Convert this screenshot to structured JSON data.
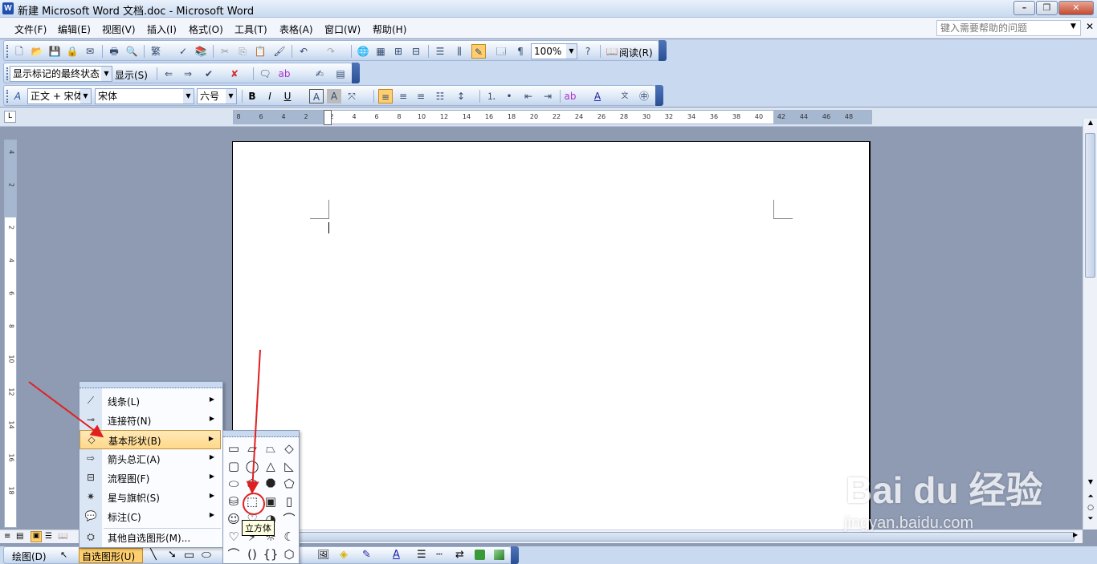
{
  "window": {
    "title": "新建 Microsoft Word 文档.doc - Microsoft Word",
    "app_icon": "W"
  },
  "menubar": {
    "items": [
      "文件(F)",
      "编辑(E)",
      "视图(V)",
      "插入(I)",
      "格式(O)",
      "工具(T)",
      "表格(A)",
      "窗口(W)",
      "帮助(H)"
    ],
    "help_placeholder": "键入需要帮助的问题"
  },
  "toolbar_standard": {
    "zoom": "100%",
    "read_label": "阅读(R)"
  },
  "toolbar_review": {
    "markup_combo": "显示标记的最终状态",
    "show_label": "显示(S)"
  },
  "toolbar_format": {
    "style": "正文 + 宋体",
    "font": "宋体",
    "size": "六号",
    "bold": "B",
    "italic": "I",
    "underline": "U"
  },
  "ruler": {
    "h_ticks": [
      "8",
      "6",
      "4",
      "2",
      "2",
      "4",
      "6",
      "8",
      "10",
      "12",
      "14",
      "16",
      "18",
      "20",
      "22",
      "24",
      "26",
      "28",
      "30",
      "32",
      "34",
      "36",
      "38",
      "40",
      "42",
      "44",
      "46",
      "48"
    ],
    "v_ticks": [
      "4",
      "2",
      "2",
      "4",
      "6",
      "8",
      "10",
      "12",
      "14",
      "16",
      "18"
    ]
  },
  "autoshapes_menu": {
    "items": [
      {
        "label": "线条(L)",
        "icon": "lines-icon",
        "glyph": "⟋"
      },
      {
        "label": "连接符(N)",
        "icon": "connector-icon",
        "glyph": "⊸"
      },
      {
        "label": "基本形状(B)",
        "icon": "basic-shapes-icon",
        "glyph": "◇"
      },
      {
        "label": "箭头总汇(A)",
        "icon": "arrows-icon",
        "glyph": "⇨"
      },
      {
        "label": "流程图(F)",
        "icon": "flowchart-icon",
        "glyph": "⊟"
      },
      {
        "label": "星与旗帜(S)",
        "icon": "stars-icon",
        "glyph": "✷"
      },
      {
        "label": "标注(C)",
        "icon": "callout-icon",
        "glyph": "💬"
      }
    ],
    "more_label": "其他自选图形(M)..."
  },
  "basic_shapes": {
    "glyphs": [
      "▭",
      "▱",
      "⏢",
      "◇",
      "▢",
      "◯",
      "△",
      "◺",
      "⬭",
      "⬡",
      "⯃",
      "⬠",
      "⛁",
      "⬚",
      "▣",
      "▯",
      "☺",
      "♡",
      "◔",
      "⌒",
      "♡",
      "⚡",
      "☼",
      "☾",
      "⌒",
      "()",
      "{}",
      "⬡"
    ],
    "tooltip": "立方体"
  },
  "drawing_toolbar": {
    "draw_label": "绘图(D)",
    "autoshapes_label": "自选图形(U)"
  },
  "watermark": {
    "brand": "Bai du 经验",
    "url": "jingyan.baidu.com"
  },
  "colors": {
    "accent_red": "#e02020",
    "menu_highlight": "#ffd88a"
  }
}
